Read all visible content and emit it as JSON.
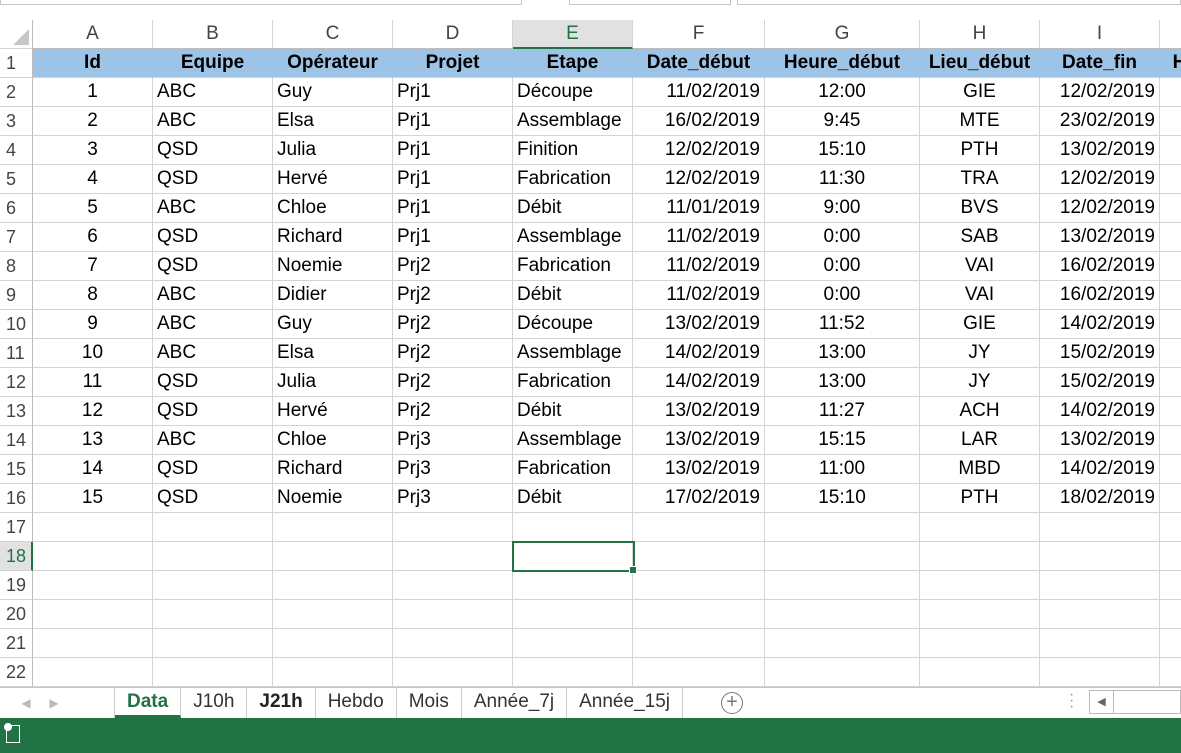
{
  "columns": [
    "A",
    "B",
    "C",
    "D",
    "E",
    "F",
    "G",
    "H",
    "I",
    ""
  ],
  "headers": [
    "Id",
    "Equipe",
    "Opérateur",
    "Projet",
    "Etape",
    "Date_début",
    "Heure_début",
    "Lieu_début",
    "Date_fin",
    "H"
  ],
  "rows": [
    [
      "1",
      "ABC",
      "Guy",
      "Prj1",
      "Découpe",
      "11/02/2019",
      "12:00",
      "GIE",
      "12/02/2019"
    ],
    [
      "2",
      "ABC",
      "Elsa",
      "Prj1",
      "Assemblage",
      "16/02/2019",
      "9:45",
      "MTE",
      "23/02/2019"
    ],
    [
      "3",
      "QSD",
      "Julia",
      "Prj1",
      "Finition",
      "12/02/2019",
      "15:10",
      "PTH",
      "13/02/2019"
    ],
    [
      "4",
      "QSD",
      "Hervé",
      "Prj1",
      "Fabrication",
      "12/02/2019",
      "11:30",
      "TRA",
      "12/02/2019"
    ],
    [
      "5",
      "ABC",
      "Chloe",
      "Prj1",
      "Débit",
      "11/01/2019",
      "9:00",
      "BVS",
      "12/02/2019"
    ],
    [
      "6",
      "QSD",
      "Richard",
      "Prj1",
      "Assemblage",
      "11/02/2019",
      "0:00",
      "SAB",
      "13/02/2019"
    ],
    [
      "7",
      "QSD",
      "Noemie",
      "Prj2",
      "Fabrication",
      "11/02/2019",
      "0:00",
      "VAI",
      "16/02/2019"
    ],
    [
      "8",
      "ABC",
      "Didier",
      "Prj2",
      "Débit",
      "11/02/2019",
      "0:00",
      "VAI",
      "16/02/2019"
    ],
    [
      "9",
      "ABC",
      "Guy",
      "Prj2",
      "Découpe",
      "13/02/2019",
      "11:52",
      "GIE",
      "14/02/2019"
    ],
    [
      "10",
      "ABC",
      "Elsa",
      "Prj2",
      "Assemblage",
      "14/02/2019",
      "13:00",
      "JY",
      "15/02/2019"
    ],
    [
      "11",
      "QSD",
      "Julia",
      "Prj2",
      "Fabrication",
      "14/02/2019",
      "13:00",
      "JY",
      "15/02/2019"
    ],
    [
      "12",
      "QSD",
      "Hervé",
      "Prj2",
      "Débit",
      "13/02/2019",
      "11:27",
      "ACH",
      "14/02/2019"
    ],
    [
      "13",
      "ABC",
      "Chloe",
      "Prj3",
      "Assemblage",
      "13/02/2019",
      "15:15",
      "LAR",
      "13/02/2019"
    ],
    [
      "14",
      "QSD",
      "Richard",
      "Prj3",
      "Fabrication",
      "13/02/2019",
      "11:00",
      "MBD",
      "14/02/2019"
    ],
    [
      "15",
      "QSD",
      "Noemie",
      "Prj3",
      "Débit",
      "17/02/2019",
      "15:10",
      "PTH",
      "18/02/2019"
    ]
  ],
  "total_rows": 22,
  "selected_cell": "E18",
  "sheet_tabs": [
    "Data",
    "J10h",
    "J21h",
    "Hebdo",
    "Mois",
    "Année_7j",
    "Année_15j"
  ],
  "active_tab": "Data",
  "add_sheet_label": "+",
  "nav_prev": "◀",
  "nav_next": "▶",
  "accent": "#217346"
}
